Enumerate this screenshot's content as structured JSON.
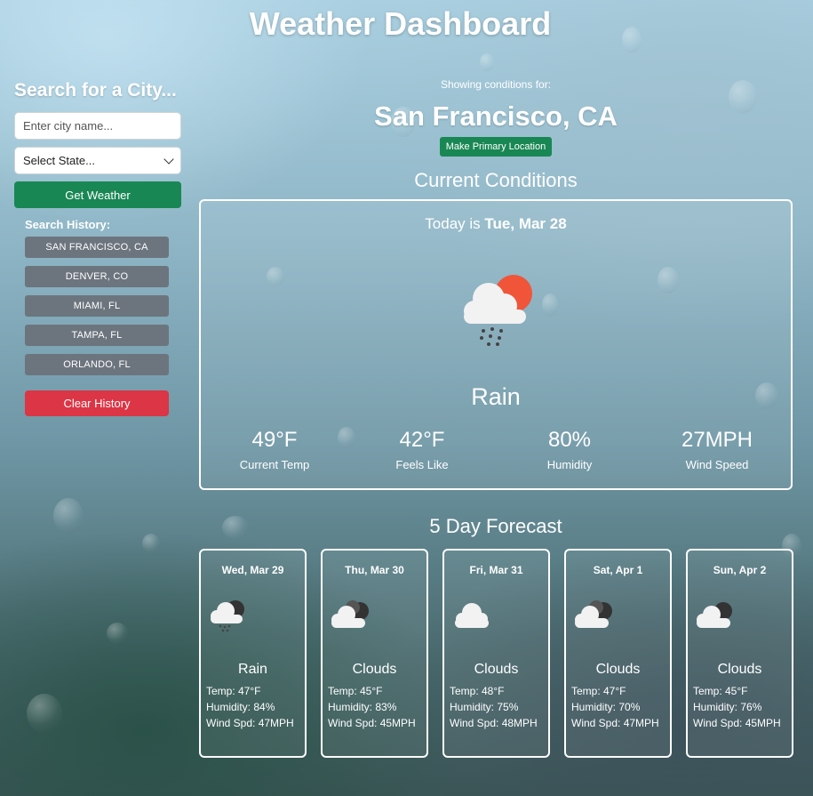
{
  "title": "Weather Dashboard",
  "sidebar": {
    "heading": "Search for a City...",
    "city_placeholder": "Enter city name...",
    "state_select": "Select State...",
    "get_weather_label": "Get Weather",
    "history_label": "Search History:",
    "history": [
      "SAN FRANCISCO, CA",
      "DENVER, CO",
      "MIAMI, FL",
      "TAMPA, FL",
      "ORLANDO, FL"
    ],
    "clear_label": "Clear History"
  },
  "main": {
    "showing": "Showing conditions for:",
    "city": "San Francisco, CA",
    "primary_label": "Make Primary Location",
    "current_title": "Current Conditions",
    "today_prefix": "Today is",
    "today_date": "Tue, Mar 28",
    "current_condition": "Rain",
    "current_icon": "rain-cloud-sun-icon",
    "stats": [
      {
        "value": "49°F",
        "label": "Current Temp"
      },
      {
        "value": "42°F",
        "label": "Feels Like"
      },
      {
        "value": "80%",
        "label": "Humidity"
      },
      {
        "value": "27MPH",
        "label": "Wind Speed"
      }
    ],
    "forecast_title": "5 Day Forecast",
    "forecast": [
      {
        "date": "Wed, Mar 29",
        "cond": "Rain",
        "icon": "rain-cloud-icon",
        "temp": "Temp: 47°F",
        "humidity": "Humidity: 84%",
        "wind": "Wind Spd: 47MPH"
      },
      {
        "date": "Thu, Mar 30",
        "cond": "Clouds",
        "icon": "dark-clouds-icon",
        "temp": "Temp: 45°F",
        "humidity": "Humidity: 83%",
        "wind": "Wind Spd: 45MPH"
      },
      {
        "date": "Fri, Mar 31",
        "cond": "Clouds",
        "icon": "cloud-icon",
        "temp": "Temp: 48°F",
        "humidity": "Humidity: 75%",
        "wind": "Wind Spd: 48MPH"
      },
      {
        "date": "Sat, Apr 1",
        "cond": "Clouds",
        "icon": "dark-clouds-icon",
        "temp": "Temp: 47°F",
        "humidity": "Humidity: 70%",
        "wind": "Wind Spd: 47MPH"
      },
      {
        "date": "Sun, Apr 2",
        "cond": "Clouds",
        "icon": "dark-clouds-icon",
        "temp": "Temp: 45°F",
        "humidity": "Humidity: 76%",
        "wind": "Wind Spd: 45MPH"
      }
    ]
  },
  "colors": {
    "success": "#198754",
    "secondary": "#6c757d",
    "danger": "#dc3545",
    "sun": "#f0553a"
  }
}
